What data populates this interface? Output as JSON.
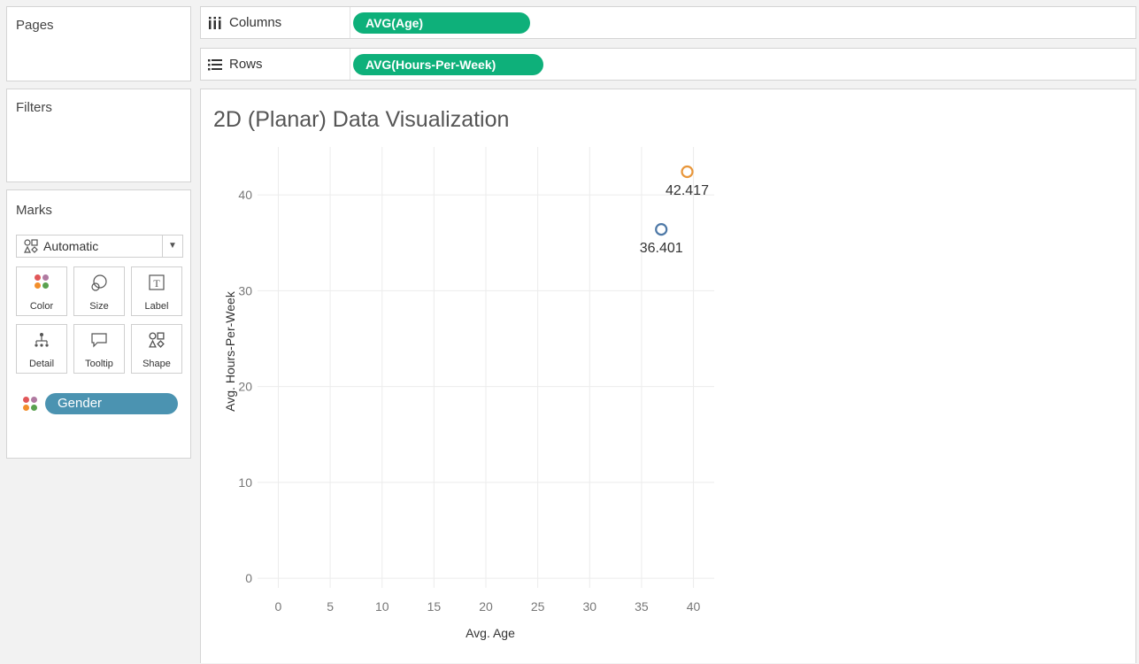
{
  "pages": {
    "title": "Pages"
  },
  "filters": {
    "title": "Filters"
  },
  "shelves": {
    "columns": {
      "label": "Columns",
      "pill": "AVG(Age)"
    },
    "rows": {
      "label": "Rows",
      "pill": "AVG(Hours-Per-Week)"
    }
  },
  "marks": {
    "title": "Marks",
    "type": "Automatic",
    "buttons": [
      {
        "label": "Color",
        "icon": "color-icon"
      },
      {
        "label": "Size",
        "icon": "size-icon"
      },
      {
        "label": "Label",
        "icon": "label-icon"
      },
      {
        "label": "Detail",
        "icon": "detail-icon"
      },
      {
        "label": "Tooltip",
        "icon": "tooltip-icon"
      },
      {
        "label": "Shape",
        "icon": "shape-icon"
      }
    ],
    "field": "Gender"
  },
  "colors": {
    "pill_green": "#0eb07a",
    "pill_blue": "#4b93b1",
    "series_orange": "#e8963a",
    "series_blue": "#4e79a7"
  },
  "chart_data": {
    "type": "scatter",
    "title": "2D (Planar) Data Visualization",
    "xlabel": "Avg. Age",
    "ylabel": "Avg. Hours-Per-Week",
    "xlim": [
      -2,
      42
    ],
    "ylim": [
      -1,
      45
    ],
    "xticks": [
      0,
      5,
      10,
      15,
      20,
      25,
      30,
      35,
      40
    ],
    "yticks": [
      0,
      10,
      20,
      30,
      40
    ],
    "grid": true,
    "points": [
      {
        "x": 39.4,
        "y": 42.417,
        "label": "42.417",
        "color": "#e8963a"
      },
      {
        "x": 36.9,
        "y": 36.401,
        "label": "36.401",
        "color": "#4e79a7"
      }
    ]
  }
}
